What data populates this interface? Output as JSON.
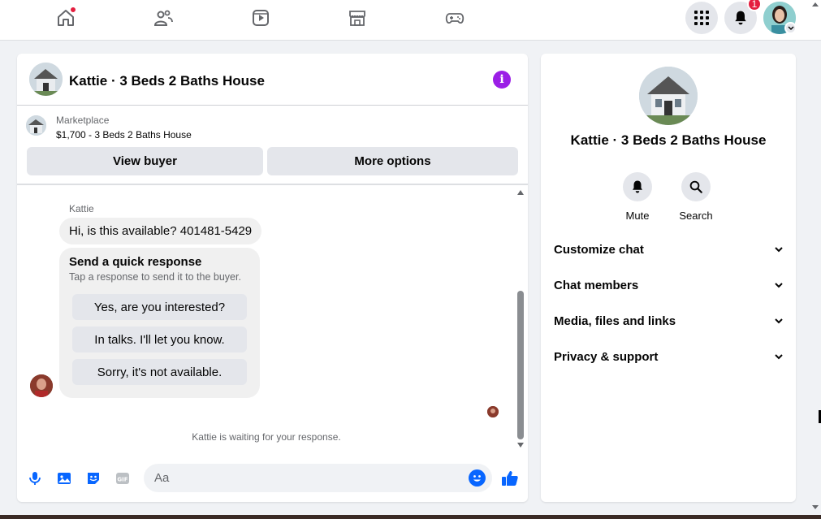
{
  "nav": {
    "icons": [
      "home-icon",
      "friends-icon",
      "video-icon",
      "marketplace-icon",
      "gaming-icon",
      "menu-grid-icon",
      "notifications-icon"
    ],
    "notification_count": "1"
  },
  "chat": {
    "title": "Kattie · 3 Beds 2 Baths House",
    "marketplace_label": "Marketplace",
    "listing": "$1,700 - 3 Beds 2 Baths House",
    "view_buyer": "View buyer",
    "more_options": "More options",
    "sender_name": "Kattie",
    "message": "Hi, is this available? 401481-5429",
    "quick_title": "Send a quick response",
    "quick_sub": "Tap a response to send it to the buyer.",
    "quick_replies": [
      "Yes, are you interested?",
      "In talks. I'll let you know.",
      "Sorry, it's not available."
    ],
    "waiting": "Kattie is waiting for your response.",
    "input_placeholder": "Aa"
  },
  "side": {
    "title": "Kattie · 3 Beds 2 Baths House",
    "mute": "Mute",
    "search": "Search",
    "sections": [
      "Customize chat",
      "Chat members",
      "Media, files and links",
      "Privacy & support"
    ]
  },
  "colors": {
    "accent": "#0866ff",
    "info": "#9b1ee6",
    "badge": "#e41e3f"
  }
}
